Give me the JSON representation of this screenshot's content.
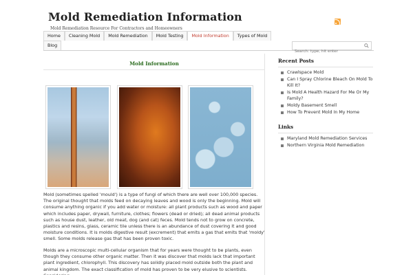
{
  "header": {
    "title": "Mold Remediation Information",
    "description": "Mold Remediation Resource For Contractors and Homeowners"
  },
  "nav": {
    "row1": [
      {
        "label": "Home"
      },
      {
        "label": "Cleaning Mold"
      },
      {
        "label": "Mold Remediation"
      },
      {
        "label": "Mold Testing"
      },
      {
        "label": "Mold Information",
        "active": true
      },
      {
        "label": "Types of Mold"
      }
    ],
    "row2": [
      {
        "label": "Blog"
      }
    ]
  },
  "search": {
    "placeholder": "Search: type, hit enter"
  },
  "post": {
    "title": "Mold Information",
    "paragraphs": [
      "Mold (sometimes spelled 'mould') is a type of fungi of which there are well over 100,000 species. The original thought that molds feed on decaying leaves and wood is only the beginning. Mold will consume anything organic if you add water or moisture: all plant products such as wood and paper which includes paper, drywall, furniture, clothes; flowers (dead or dried); all dead animal products such as house dust, leather, old meat, dog (and cat) feces. Mold tends not to grow on concrete, plastics and resins, glass, ceramic tile unless there is an abundance of dust covering it and good moisture conditions. It is molds digestive result (excrement) that emits a gas that emits that 'moldy' smell. Some molds release gas that has been proven toxic.",
      "Molds are a microscopic multi-cellular organism that for years were thought to be plants, even though they consume other organic matter. Then it was discover that molds lack that important plant ingredient, chlorophyll. This discovery has solidly placed mold outside both the plant and animal kingdom. The exact classification of mold has proven to be very elusive to scientists. Considering"
    ]
  },
  "sidebar": {
    "recent_heading": "Recent Posts",
    "recent": [
      "Crawlspace Mold",
      "Can I Spray Chlorine Bleach On Mold To Kill It?",
      "Is Mold A Health Hazard For Me Or My Family?",
      "Moldy Basement Smell",
      "How To Prevent Mold In My Home"
    ],
    "links_heading": "Links",
    "links": [
      "Maryland Mold Remediation Services",
      "Northern Virginia Mold Remediation"
    ]
  },
  "colors": {
    "accent_nav": "#c0392b",
    "post_title": "#2a6b1e",
    "rss": "#f7a53a"
  }
}
